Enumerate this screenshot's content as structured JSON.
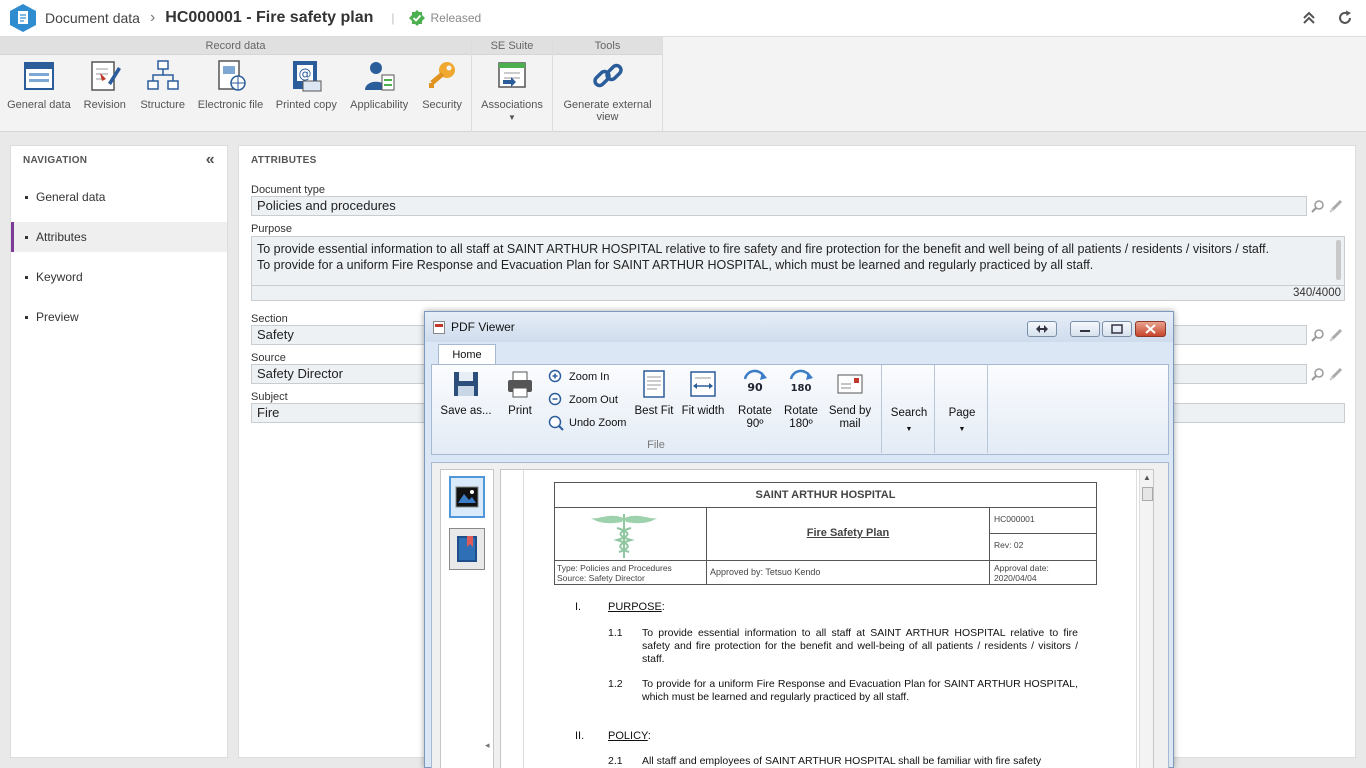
{
  "header": {
    "breadcrumb": "Document data",
    "title": "HC000001 - Fire safety plan",
    "status": "Released"
  },
  "ribbon": {
    "groups": [
      {
        "title": "Record data",
        "buttons": [
          "General data",
          "Revision",
          "Structure",
          "Electronic file",
          "Printed copy",
          "Applicability",
          "Security"
        ]
      },
      {
        "title": "SE Suite",
        "buttons": [
          "Associations"
        ]
      },
      {
        "title": "Tools",
        "buttons": [
          "Generate external view"
        ]
      }
    ],
    "tools_line1": "Generate external",
    "tools_line2": "view"
  },
  "navigation": {
    "title": "NAVIGATION",
    "items": [
      {
        "label": "General data"
      },
      {
        "label": "Attributes"
      },
      {
        "label": "Keyword"
      },
      {
        "label": "Preview"
      }
    ]
  },
  "attributes": {
    "title": "ATTRIBUTES",
    "document_type_label": "Document type",
    "document_type_value": "Policies and procedures",
    "purpose_label": "Purpose",
    "purpose_line1": "To provide essential information to all staff at SAINT ARTHUR HOSPITAL relative to fire safety and fire protection for the benefit and well being of all patients / residents / visitors / staff.",
    "purpose_line2": "To provide for a uniform Fire Response and Evacuation Plan for SAINT ARTHUR HOSPITAL, which must be learned and regularly practiced by all staff.",
    "purpose_count": "340/4000",
    "section_label": "Section",
    "section_value": "Safety",
    "source_label": "Source",
    "source_value": "Safety Director",
    "subject_label": "Subject",
    "subject_value": "Fire"
  },
  "pdf_viewer": {
    "title": "PDF Viewer",
    "tab_home": "Home",
    "save_as": "Save as...",
    "print": "Print",
    "zoom_in": "Zoom In",
    "zoom_out": "Zoom Out",
    "undo_zoom": "Undo Zoom",
    "best_fit": "Best Fit",
    "fit_width": "Fit width",
    "rotate90_l1": "Rotate",
    "rotate90_l2": "90º",
    "rotate180_l1": "Rotate",
    "rotate180_l2": "180º",
    "send_l1": "Send by",
    "send_l2": "mail",
    "search": "Search",
    "page": "Page",
    "group_file": "File",
    "icon_rot90": "90",
    "icon_rot180": "180"
  },
  "document": {
    "hospital": "SAINT ARTHUR HOSPITAL",
    "doc_title": "Fire Safety Plan",
    "code": "HC000001",
    "rev": "Rev: 02",
    "type": "Type: Policies and Procedures",
    "source": "Source: Safety Director",
    "approved_by": "Approved by: Tetsuo Kendo",
    "approval_date_label": "Approval date:",
    "approval_date": "2020/04/04",
    "s1_num": "I.",
    "s1_title": "PURPOSE",
    "s1_colon": ":",
    "p11_num": "1.1",
    "p11": "To provide essential information to all staff at SAINT ARTHUR HOSPITAL relative to fire safety and fire protection for the benefit and well-being of all patients / residents / visitors / staff.",
    "p12_num": "1.2",
    "p12": "To provide for a uniform Fire Response and Evacuation Plan for SAINT ARTHUR HOSPITAL, which must be learned and regularly practiced by all staff.",
    "s2_num": "II.",
    "s2_title": "POLICY",
    "s2_colon": ":",
    "p21_num": "2.1",
    "p21": "All staff and employees of SAINT ARTHUR HOSPITAL shall be familiar with fire safety"
  },
  "colors": {
    "accent": "#7d3c98",
    "released": "#4caf50",
    "logo": "#2f8ccf"
  }
}
